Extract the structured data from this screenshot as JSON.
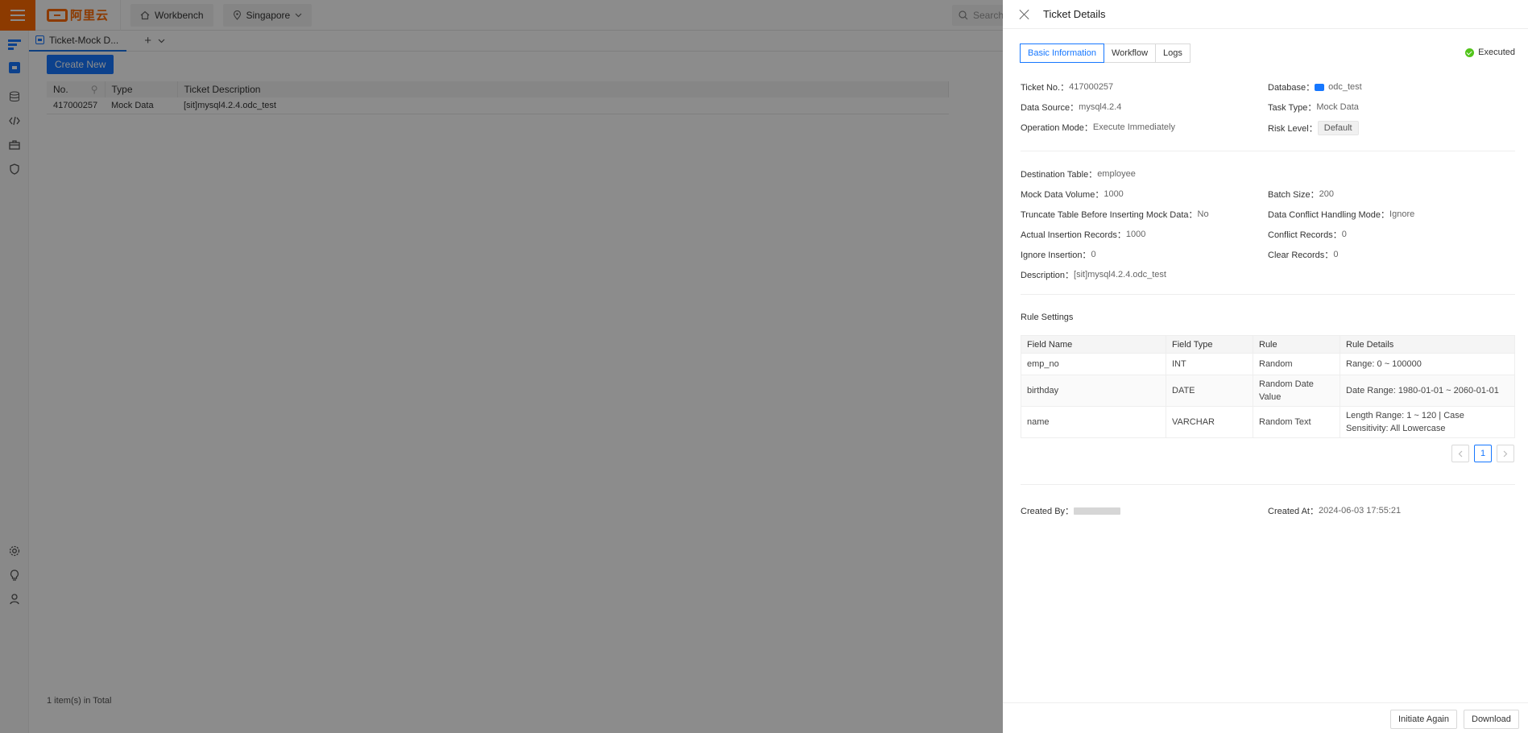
{
  "topbar": {
    "logo_text": "阿里云",
    "workbench": "Workbench",
    "region": "Singapore",
    "search_placeholder": "Search"
  },
  "tabs": {
    "active_label": "Ticket-Mock D..."
  },
  "list": {
    "create_label": "Create New",
    "columns": [
      "No.",
      "Type",
      "Ticket Description"
    ],
    "rows": [
      {
        "no": "417000257",
        "type": "Mock Data",
        "desc": "[sit]mysql4.2.4.odc_test"
      }
    ],
    "total": "1 item(s) in Total"
  },
  "drawer": {
    "title": "Ticket Details",
    "tabs": [
      "Basic Information",
      "Workflow",
      "Logs"
    ],
    "status": "Executed",
    "fields": {
      "ticket_no": {
        "label": "Ticket No.：",
        "value": "417000257"
      },
      "database": {
        "label": "Database：",
        "value": "odc_test"
      },
      "data_source": {
        "label": "Data Source：",
        "value": "mysql4.2.4"
      },
      "task_type": {
        "label": "Task Type：",
        "value": "Mock Data"
      },
      "operation_mode": {
        "label": "Operation Mode：",
        "value": "Execute Immediately"
      },
      "risk_level": {
        "label": "Risk Level：",
        "value": "Default"
      },
      "dest_table": {
        "label": "Destination Table：",
        "value": "employee"
      },
      "mock_volume": {
        "label": "Mock Data Volume：",
        "value": "1000"
      },
      "batch_size": {
        "label": "Batch Size：",
        "value": "200"
      },
      "truncate": {
        "label": "Truncate Table Before Inserting Mock Data：",
        "value": "No"
      },
      "conflict_mode": {
        "label": "Data Conflict Handling Mode：",
        "value": "Ignore"
      },
      "actual_records": {
        "label": "Actual Insertion Records：",
        "value": "1000"
      },
      "conflict_records": {
        "label": "Conflict Records：",
        "value": "0"
      },
      "ignore_insertion": {
        "label": "Ignore Insertion：",
        "value": "0"
      },
      "clear_records": {
        "label": "Clear Records：",
        "value": "0"
      },
      "description": {
        "label": "Description：",
        "value": "[sit]mysql4.2.4.odc_test"
      },
      "created_by": {
        "label": "Created By：",
        "value": ""
      },
      "created_at": {
        "label": "Created At：",
        "value": "2024-06-03 17:55:21"
      }
    },
    "rule_settings_title": "Rule Settings",
    "rule_columns": [
      "Field Name",
      "Field Type",
      "Rule",
      "Rule Details"
    ],
    "rules": [
      {
        "field": "emp_no",
        "type": "INT",
        "rule": "Random",
        "details": "Range: 0 ~ 100000"
      },
      {
        "field": "birthday",
        "type": "DATE",
        "rule": "Random Date Value",
        "details": "Date Range: 1980-01-01 ~ 2060-01-01"
      },
      {
        "field": "name",
        "type": "VARCHAR",
        "rule": "Random Text",
        "details": "Length Range: 1 ~ 120 | Case Sensitivity: All Lowercase"
      }
    ],
    "page": "1",
    "buttons": {
      "initiate_again": "Initiate Again",
      "download": "Download"
    }
  },
  "colors": {
    "accent": "#1677ff",
    "brand": "#ff6a00",
    "success": "#52c41a"
  }
}
